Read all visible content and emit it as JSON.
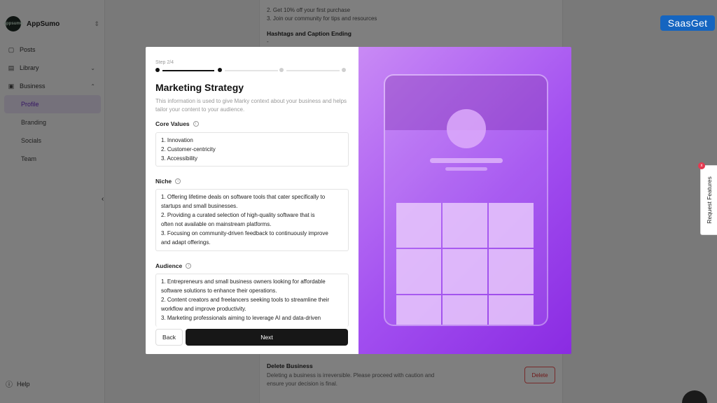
{
  "brand_badge": "SaasGet",
  "sidebar": {
    "workspace_name": "AppSumo",
    "workspace_logo_text": "appsumo",
    "items": [
      {
        "label": "Posts"
      },
      {
        "label": "Library"
      },
      {
        "label": "Business"
      }
    ],
    "sub_items": [
      {
        "label": "Profile",
        "active": true
      },
      {
        "label": "Branding"
      },
      {
        "label": "Socials"
      },
      {
        "label": "Team"
      }
    ],
    "help_label": "Help"
  },
  "background_content": {
    "line1": "2. Get 10% off your first purchase",
    "line2": "3. Join our community for tips and resources",
    "hashtags_heading": "Hashtags and Caption Ending",
    "hashtags_value": "-",
    "delete_title": "Delete Business",
    "delete_desc": "Deleting a business is irreversible. Please proceed with caution and ensure your decision is final.",
    "delete_button": "Delete"
  },
  "request_features": {
    "label": "Request Features",
    "badge": "x"
  },
  "modal": {
    "step_label": "Step 2/4",
    "progress": {
      "current_step": 2,
      "total_steps": 4
    },
    "title": "Marketing Strategy",
    "subtitle": "This information is used to give Marky context about your business and helps tailor your content to your audience.",
    "core_values": {
      "label": "Core Values",
      "lines": [
        "1. Innovation",
        "2. Customer-centricity",
        "3. Accessibility"
      ]
    },
    "niche": {
      "label": "Niche",
      "lines": [
        "1. Offering lifetime deals on software tools that cater specifically to",
        "startups and small businesses.",
        "2. Providing a curated selection of high-quality software that is",
        "often not available on mainstream platforms.",
        "3. Focusing on community-driven feedback to continuously improve",
        "and adapt offerings."
      ]
    },
    "audience": {
      "label": "Audience",
      "lines": [
        "1. Entrepreneurs and small business owners looking for affordable",
        "software solutions to enhance their operations.",
        "2. Content creators and freelancers seeking tools to streamline their",
        "workflow and improve productivity.",
        "3. Marketing professionals aiming to leverage AI and data-driven"
      ]
    },
    "back_button": "Back",
    "next_button": "Next"
  },
  "colors": {
    "accent": "#a24ff0",
    "active_nav_text": "#6d2fc7",
    "next_button_bg": "#171717",
    "brand_badge_bg": "#1565c0"
  }
}
